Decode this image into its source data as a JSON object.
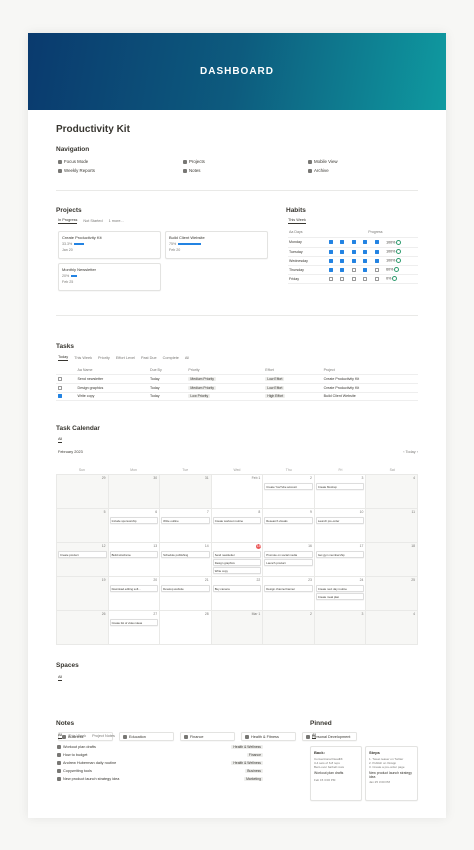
{
  "banner": {
    "title": "DASHBOARD"
  },
  "page_title": "Productivity Kit",
  "navigation": {
    "heading": "Navigation",
    "items": [
      "Focus Mode",
      "Weekly Reports",
      "Projects",
      "Notes",
      "Mobile View",
      "Archive"
    ]
  },
  "projects": {
    "heading": "Projects",
    "tabs": [
      "In Progress",
      "Not Started",
      "1 more..."
    ],
    "cards": [
      {
        "name": "Create Productivity Kit",
        "pct": "33.3%",
        "pct_value": 0.333,
        "date": "Jan 20"
      },
      {
        "name": "Build Client Website",
        "pct": "75%",
        "pct_value": 0.75,
        "date": "Feb 20"
      },
      {
        "name": "Monthly Newsletter",
        "pct": "20%",
        "pct_value": 0.2,
        "date": "Feb 25"
      }
    ]
  },
  "habits": {
    "heading": "Habits",
    "tab": "This Week",
    "col_day": "Aa Days",
    "col_progress": "Progress",
    "rows": [
      {
        "day": "Monday",
        "checks": [
          1,
          1,
          1,
          1,
          1
        ],
        "pct": "100%"
      },
      {
        "day": "Tuesday",
        "checks": [
          1,
          1,
          1,
          1,
          1
        ],
        "pct": "100%"
      },
      {
        "day": "Wednesday",
        "checks": [
          1,
          1,
          1,
          1,
          1
        ],
        "pct": "100%"
      },
      {
        "day": "Thursday",
        "checks": [
          1,
          1,
          0,
          1,
          0
        ],
        "pct": "60%"
      },
      {
        "day": "Friday",
        "checks": [
          0,
          0,
          0,
          0,
          0
        ],
        "pct": "0%"
      }
    ]
  },
  "tasks": {
    "heading": "Tasks",
    "tabs": [
      "Today",
      "This Week",
      "Priority",
      "Effort Level",
      "Past Due",
      "Complete",
      "All"
    ],
    "columns": [
      "Aa Name",
      "Due By",
      "Priority",
      "Effort",
      "Project"
    ],
    "rows": [
      {
        "name": "Send newsletter",
        "due": "Today",
        "priority": "Medium Priority",
        "effort": "Low Effort",
        "project": "Create Productivity Kit",
        "done": false
      },
      {
        "name": "Design graphics",
        "due": "Today",
        "priority": "Medium Priority",
        "effort": "Low Effort",
        "project": "Create Productivity Kit",
        "done": false
      },
      {
        "name": "Write copy",
        "due": "Today",
        "priority": "Low Priority",
        "effort": "High Effort",
        "project": "Build Client Website",
        "done": true
      }
    ]
  },
  "calendar": {
    "heading": "Task Calendar",
    "tab": "All",
    "month": "February 2023",
    "today_label": "Today",
    "weekdays": [
      "Sun",
      "Mon",
      "Tue",
      "Wed",
      "Thu",
      "Fri",
      "Sat"
    ],
    "weeks": [
      [
        {
          "d": "29",
          "off": true
        },
        {
          "d": "30",
          "off": true
        },
        {
          "d": "31",
          "off": true
        },
        {
          "d": "Feb 1",
          "ev": []
        },
        {
          "d": "2",
          "ev": [
            "Create YouTube account"
          ]
        },
        {
          "d": "3",
          "ev": [
            "Create Mockup"
          ]
        },
        {
          "d": "4",
          "off": true
        }
      ],
      [
        {
          "d": "5",
          "off": true
        },
        {
          "d": "6",
          "ev": [
            "Include sponsorship"
          ]
        },
        {
          "d": "7",
          "ev": [
            "Write outline"
          ]
        },
        {
          "d": "8",
          "ev": [
            "Create workout routine"
          ]
        },
        {
          "d": "9",
          "ev": [
            "Research visuals"
          ]
        },
        {
          "d": "10",
          "ev": [
            "Launch pre-order"
          ]
        },
        {
          "d": "11",
          "off": true
        }
      ],
      [
        {
          "d": "12",
          "ev": [
            "Create product"
          ],
          "off": true
        },
        {
          "d": "13",
          "ev": [
            "Build wireframe"
          ]
        },
        {
          "d": "14",
          "ev": [
            "Schedule publishing"
          ]
        },
        {
          "d": "15",
          "today": true,
          "ev": [
            "Send newsletter",
            "Design graphics",
            "Write copy"
          ]
        },
        {
          "d": "16",
          "ev": [
            "Promote on social media",
            "Launch product"
          ]
        },
        {
          "d": "17",
          "ev": [
            "Get gym membership"
          ]
        },
        {
          "d": "18",
          "off": true
        }
      ],
      [
        {
          "d": "19",
          "off": true
        },
        {
          "d": "20",
          "ev": [
            "Download editing soft..."
          ]
        },
        {
          "d": "21",
          "ev": [
            "Develop website"
          ]
        },
        {
          "d": "22",
          "ev": [
            "Buy camera"
          ]
        },
        {
          "d": "23",
          "ev": [
            "Design channel banner"
          ]
        },
        {
          "d": "24",
          "ev": [
            "Create next day routine",
            "Create meal plan"
          ]
        },
        {
          "d": "25",
          "off": true
        }
      ],
      [
        {
          "d": "26",
          "off": true
        },
        {
          "d": "27",
          "ev": [
            "Create list of video ideas"
          ]
        },
        {
          "d": "28",
          "ev": []
        },
        {
          "d": "Mar 1",
          "off": true
        },
        {
          "d": "2",
          "off": true
        },
        {
          "d": "3",
          "off": true
        },
        {
          "d": "4",
          "off": true
        }
      ]
    ]
  },
  "spaces": {
    "heading": "Spaces",
    "tab": "All",
    "items": [
      "Business",
      "Education",
      "Finance",
      "Health & Fitness",
      "Personal Development"
    ]
  },
  "notes": {
    "heading": "Notes",
    "tabs": [
      "All",
      "This Week",
      "Project Notes"
    ],
    "rows": [
      {
        "name": "Workout plan drafts",
        "tag": "Health & Wellness"
      },
      {
        "name": "How to budget",
        "tag": "Finance"
      },
      {
        "name": "Andrew Huberman daily routine",
        "tag": "Health & Wellness"
      },
      {
        "name": "Copywriting tools",
        "tag": "Business"
      },
      {
        "name": "New product launch strategy idea",
        "tag": "Marketing"
      }
    ]
  },
  "pinned": {
    "heading": "Pinned",
    "tab": "All",
    "back": {
      "title": "Back:",
      "sub": "Conventional Deadlift",
      "lines": [
        "3-4 sets of 6-8 reps",
        "Bent-over barbell rows"
      ],
      "item": "Workout plan drafts",
      "date": "Feb 15 3:00 PM"
    },
    "steps": {
      "title": "Steps",
      "lines": [
        "1. Tweet teaser on Twitter",
        "2. Publish on IG/app",
        "3. Create a pre-order page"
      ],
      "item": "New product launch strategy idea",
      "date": "Jan 25 3:00 PM"
    }
  }
}
